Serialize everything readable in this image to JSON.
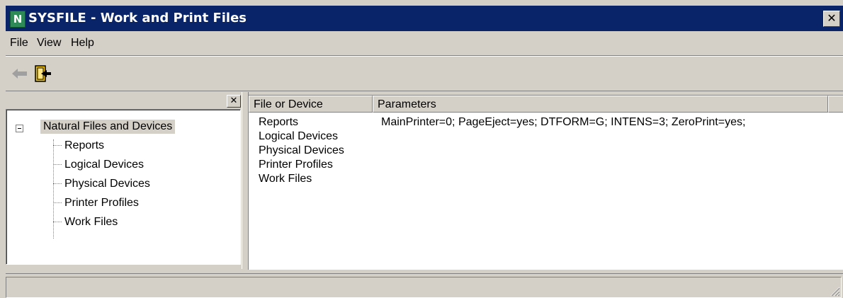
{
  "window": {
    "app_icon_letter": "N",
    "title": "SYSFILE - Work and Print Files",
    "close_glyph": "✕"
  },
  "menubar": {
    "items": [
      {
        "label": "File"
      },
      {
        "label": "View"
      },
      {
        "label": "Help"
      }
    ]
  },
  "toolbar": {
    "buttons": [
      {
        "icon": "back-arrow-icon",
        "enabled": false
      },
      {
        "icon": "exit-door-icon",
        "enabled": true
      }
    ]
  },
  "tree": {
    "close_glyph": "✕",
    "root": {
      "label": "Natural Files and Devices",
      "expanded": true
    },
    "children": [
      {
        "label": "Reports"
      },
      {
        "label": "Logical Devices"
      },
      {
        "label": "Physical Devices"
      },
      {
        "label": "Printer Profiles"
      },
      {
        "label": "Work Files"
      }
    ]
  },
  "list": {
    "columns": [
      {
        "label": "File or Device"
      },
      {
        "label": "Parameters"
      }
    ],
    "rows": [
      {
        "name": "Reports",
        "params": "MainPrinter=0; PageEject=yes; DTFORM=G; INTENS=3; ZeroPrint=yes;"
      },
      {
        "name": "Logical Devices",
        "params": ""
      },
      {
        "name": "Physical Devices",
        "params": ""
      },
      {
        "name": "Printer Profiles",
        "params": ""
      },
      {
        "name": "Work Files",
        "params": ""
      }
    ]
  },
  "colors": {
    "titlebar": "#0a246a",
    "face": "#d4d0c8"
  }
}
